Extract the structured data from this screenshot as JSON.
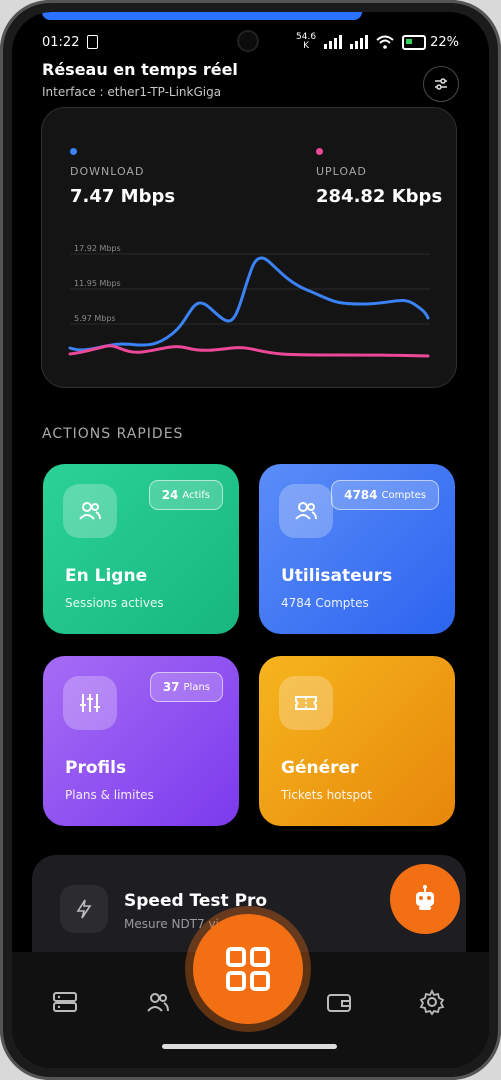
{
  "status": {
    "time": "01:22",
    "speed_value": "54.6",
    "speed_unit": "K",
    "battery": "22%"
  },
  "header": {
    "title": "Réseau en temps réel",
    "subtitle": "Interface : ether1-TP-LinkGiga"
  },
  "network": {
    "download_label": "DOWNLOAD",
    "download_value": "7.47 Mbps",
    "download_color": "#3b82f6",
    "upload_label": "UPLOAD",
    "upload_value": "284.82 Kbps",
    "upload_color": "#ec4899",
    "y_ticks": [
      "17.92 Mbps",
      "11.95 Mbps",
      "5.97 Mbps"
    ]
  },
  "section_label": "ACTIONS RAPIDES",
  "tiles": [
    {
      "title": "En Ligne",
      "subtitle": "Sessions actives",
      "badge_value": "24",
      "badge_unit": "Actifs",
      "color_from": "#2bd296",
      "color_to": "#17b77f",
      "icon": "users-icon"
    },
    {
      "title": "Utilisateurs",
      "subtitle": "4784 Comptes",
      "badge_value": "4784",
      "badge_unit": "Comptes",
      "color_from": "#5b8df8",
      "color_to": "#2c64f0",
      "icon": "users-icon"
    },
    {
      "title": "Profils",
      "subtitle": "Plans & limites",
      "badge_value": "37",
      "badge_unit": "Plans",
      "color_from": "#a66cf5",
      "color_to": "#7c3aed",
      "icon": "sliders-icon"
    },
    {
      "title": "Générer",
      "subtitle": "Tickets hotspot",
      "badge_value": "",
      "badge_unit": "",
      "color_from": "#f6b51d",
      "color_to": "#e7870b",
      "icon": "ticket-icon"
    }
  ],
  "speed_test": {
    "title": "Speed Test Pro",
    "subtitle": "Mesure NDT7 via M-Lab"
  },
  "accent": "#f26f14"
}
